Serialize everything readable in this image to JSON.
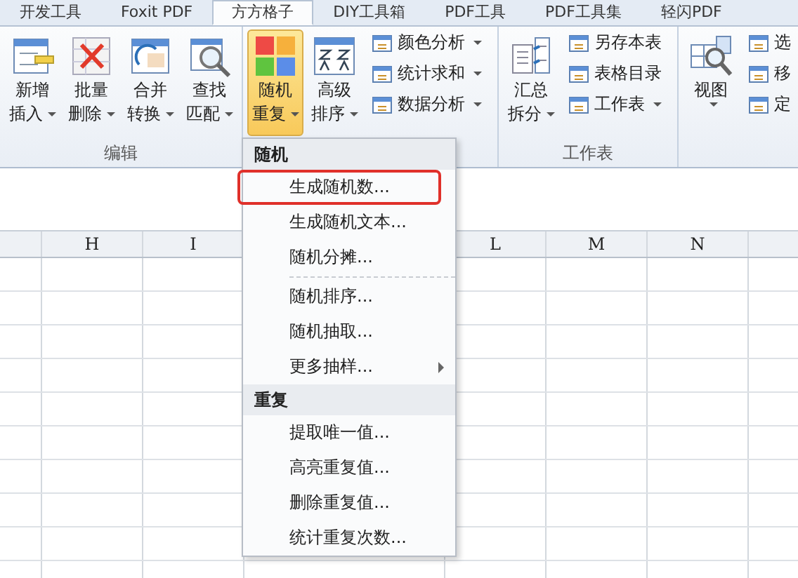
{
  "ribbon_tabs": [
    {
      "label": "开发工具",
      "selected": false
    },
    {
      "label": "Foxit PDF",
      "selected": false
    },
    {
      "label": "方方格子",
      "selected": true
    },
    {
      "label": "DIY工具箱",
      "selected": false
    },
    {
      "label": "PDF工具",
      "selected": false
    },
    {
      "label": "PDF工具集",
      "selected": false
    },
    {
      "label": "轻闪PDF",
      "selected": false
    }
  ],
  "groups": [
    {
      "label": "编辑",
      "large": [
        {
          "line1": "新增",
          "line2": "插入",
          "dropdown": true,
          "pressed": false
        },
        {
          "line1": "批量",
          "line2": "删除",
          "dropdown": true,
          "pressed": false
        },
        {
          "line1": "合并",
          "line2": "转换",
          "dropdown": true,
          "pressed": false
        },
        {
          "line1": "查找",
          "line2": "匹配",
          "dropdown": true,
          "pressed": false
        }
      ]
    },
    {
      "large": [
        {
          "line1": "随机",
          "line2": "重复",
          "dropdown": true,
          "pressed": true
        },
        {
          "line1": "高级",
          "line2": "排序",
          "dropdown": true,
          "pressed": false
        }
      ],
      "small": [
        {
          "label": "颜色分析",
          "dropdown": true
        },
        {
          "label": "统计求和",
          "dropdown": true
        },
        {
          "label": "数据分析",
          "dropdown": true
        }
      ]
    },
    {
      "label": "工作表",
      "large": [
        {
          "line1": "汇总",
          "line2": "拆分",
          "dropdown": true,
          "pressed": false
        }
      ],
      "small": [
        {
          "label": "另存本表",
          "dropdown": false
        },
        {
          "label": "表格目录",
          "dropdown": false
        },
        {
          "label": "工作表",
          "dropdown": true
        }
      ]
    },
    {
      "large": [
        {
          "line1": "视图",
          "dropdown": true,
          "pressed": false
        }
      ],
      "small": [
        {
          "label": "选",
          "dropdown": false
        },
        {
          "label": "移",
          "dropdown": false
        },
        {
          "label": "定",
          "dropdown": false
        }
      ]
    }
  ],
  "columns_left": [
    "H",
    "I"
  ],
  "columns_right": [
    "L",
    "M",
    "N"
  ],
  "menu": [
    {
      "heading": "随机",
      "items": [
        {
          "label": "生成随机数...",
          "highlighted": true,
          "submenu": false,
          "separator_before": false
        },
        {
          "label": "生成随机文本...",
          "highlighted": false,
          "submenu": false,
          "separator_before": false
        },
        {
          "label": "随机分摊...",
          "highlighted": false,
          "submenu": false,
          "separator_before": false
        },
        {
          "label": "随机排序...",
          "highlighted": false,
          "submenu": false,
          "separator_before": true
        },
        {
          "label": "随机抽取...",
          "highlighted": false,
          "submenu": false,
          "separator_before": false
        },
        {
          "label": "更多抽样...",
          "highlighted": false,
          "submenu": true,
          "separator_before": false
        }
      ]
    },
    {
      "heading": "重复",
      "items": [
        {
          "label": "提取唯一值...",
          "highlighted": false,
          "submenu": false,
          "separator_before": false
        },
        {
          "label": "高亮重复值...",
          "highlighted": false,
          "submenu": false,
          "separator_before": false
        },
        {
          "label": "删除重复值...",
          "highlighted": false,
          "submenu": false,
          "separator_before": false
        },
        {
          "label": "统计重复次数...",
          "highlighted": false,
          "submenu": false,
          "separator_before": false
        }
      ]
    }
  ]
}
